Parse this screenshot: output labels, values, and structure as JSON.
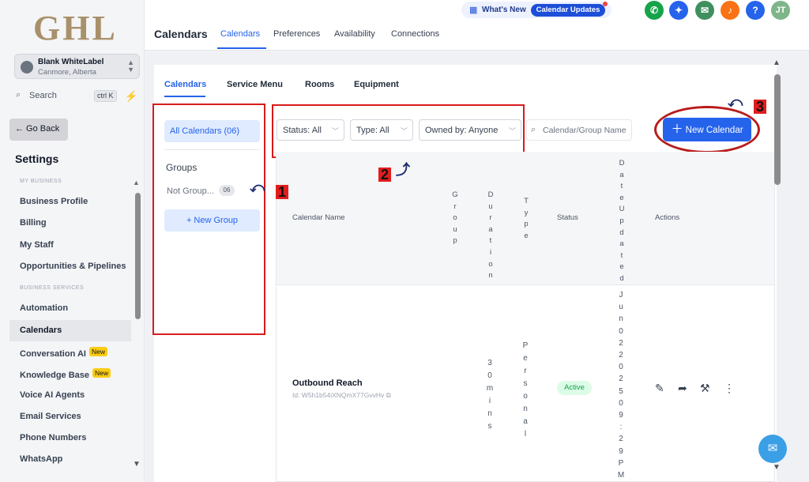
{
  "sidebar": {
    "logo": "GHL",
    "account": {
      "name": "Blank WhiteLabel",
      "location": "Canmore, Alberta"
    },
    "search": {
      "label": "Search",
      "shortcut": "ctrl K"
    },
    "go_back": "← Go Back",
    "title": "Settings",
    "sections": [
      {
        "heading": "MY BUSINESS"
      },
      {
        "heading": "BUSINESS SERVICES"
      }
    ],
    "items": [
      {
        "label": "Business Profile"
      },
      {
        "label": "Billing"
      },
      {
        "label": "My Staff"
      },
      {
        "label": "Opportunities & Pipelines"
      },
      {
        "label": "Automation"
      },
      {
        "label": "Calendars",
        "active": true
      },
      {
        "label": "Conversation AI",
        "badge": "New"
      },
      {
        "label": "Knowledge Base",
        "badge": "New"
      },
      {
        "label": "Voice AI Agents"
      },
      {
        "label": "Email Services"
      },
      {
        "label": "Phone Numbers"
      },
      {
        "label": "WhatsApp"
      }
    ]
  },
  "topbar": {
    "whats_new": "What's New",
    "calendar_updates": "Calendar Updates",
    "avatar_initials": "JT",
    "page_title": "Calendars",
    "tabs": [
      {
        "label": "Calendars",
        "active": true
      },
      {
        "label": "Preferences"
      },
      {
        "label": "Availability"
      },
      {
        "label": "Connections"
      }
    ],
    "icon_colors": {
      "phone": "#16a34a",
      "magic": "#2563eb",
      "megaphone": "#3f8f5f",
      "bell": "#f97316",
      "help": "#2563eb",
      "avatar": "#7fb58a"
    }
  },
  "main": {
    "sub_tabs": [
      {
        "label": "Calendars",
        "active": true
      },
      {
        "label": "Service Menu"
      },
      {
        "label": "Rooms"
      },
      {
        "label": "Equipment"
      }
    ],
    "all_calendars": "All Calendars (06)",
    "groups_heading": "Groups",
    "not_grouped": "Not Group...",
    "not_grouped_count": "06",
    "new_group": "+ New Group",
    "filters": [
      {
        "label": "Status: All"
      },
      {
        "label": "Type: All"
      },
      {
        "label": "Owned by: Anyone"
      }
    ],
    "search_placeholder": "Calendar/Group Name",
    "new_calendar": "New Calendar",
    "table": {
      "col_name": "Calendar Name",
      "col_group": "Group",
      "col_duration": "Duration",
      "col_type": "Type",
      "col_status": "Status",
      "col_date": "DateUpdated",
      "col_actions": "Actions",
      "row": {
        "name": "Outbound Reach",
        "id": "Id: W5h1b54iXNQmX77GvvHv",
        "duration": "30mins",
        "type": "Personal",
        "status": "Active",
        "date": "Jun02202509:29PM"
      }
    },
    "annotations": [
      "1",
      "2",
      "3"
    ]
  }
}
